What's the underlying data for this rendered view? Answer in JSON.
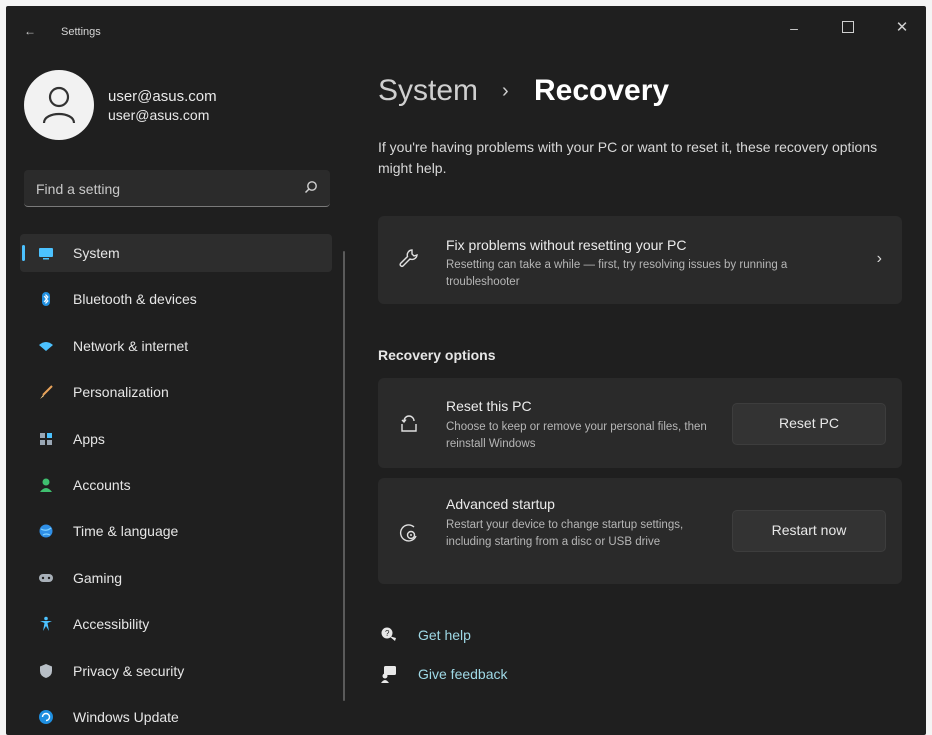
{
  "window": {
    "title": "Settings",
    "back_glyph": "←",
    "minimize_glyph": "–",
    "close_glyph": "✕"
  },
  "profile": {
    "name": "user@asus.com",
    "email": "user@asus.com"
  },
  "search": {
    "placeholder": "Find a setting"
  },
  "sidebar": {
    "items": [
      {
        "label": "System",
        "icon": "system-icon",
        "selected": true
      },
      {
        "label": "Bluetooth & devices",
        "icon": "bluetooth-icon"
      },
      {
        "label": "Network & internet",
        "icon": "network-icon"
      },
      {
        "label": "Personalization",
        "icon": "brush-icon"
      },
      {
        "label": "Apps",
        "icon": "apps-icon"
      },
      {
        "label": "Accounts",
        "icon": "accounts-icon"
      },
      {
        "label": "Time & language",
        "icon": "globe-icon"
      },
      {
        "label": "Gaming",
        "icon": "controller-icon"
      },
      {
        "label": "Accessibility",
        "icon": "accessibility-icon"
      },
      {
        "label": "Privacy & security",
        "icon": "shield-icon"
      },
      {
        "label": "Windows Update",
        "icon": "update-icon"
      }
    ]
  },
  "main": {
    "breadcrumb_parent": "System",
    "breadcrumb_sep": "›",
    "breadcrumb_current": "Recovery",
    "description": "If you're having problems with your PC or want to reset it, these recovery options might help.",
    "fix_card": {
      "title": "Fix problems without resetting your PC",
      "subtitle": "Resetting can take a while — first, try resolving issues by running a troubleshooter",
      "chevron": "›"
    },
    "section_title": "Recovery options",
    "reset_card": {
      "title": "Reset this PC",
      "subtitle": "Choose to keep or remove your personal files, then reinstall Windows",
      "button": "Reset PC"
    },
    "advanced_card": {
      "title": "Advanced startup",
      "subtitle": "Restart your device to change startup settings, including starting from a disc or USB drive",
      "button": "Restart now"
    },
    "links": {
      "help": "Get help",
      "feedback": "Give feedback"
    }
  },
  "colors": {
    "background": "#1f1f1f",
    "card": "#2a2a2a",
    "accent": "#4cc2ff",
    "link": "#9fd9e6"
  }
}
